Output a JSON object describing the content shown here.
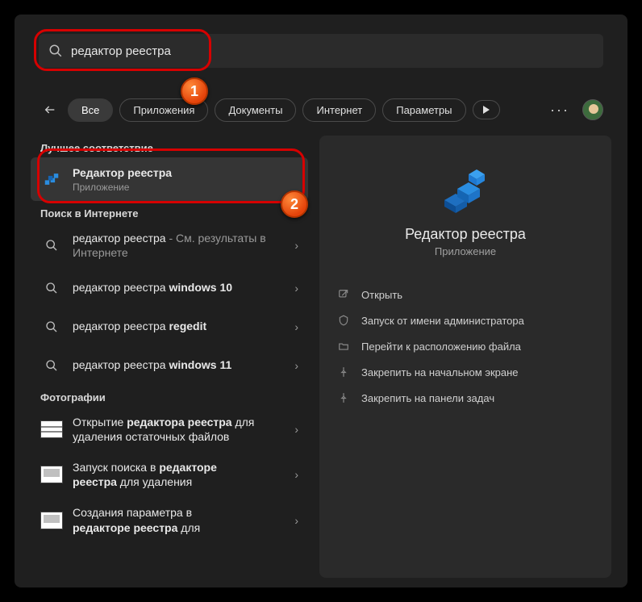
{
  "search": {
    "query": "редактор реестра"
  },
  "filters": {
    "items": [
      {
        "label": "Все",
        "active": true
      },
      {
        "label": "Приложения",
        "active": false
      },
      {
        "label": "Документы",
        "active": false
      },
      {
        "label": "Интернет",
        "active": false
      },
      {
        "label": "Параметры",
        "active": false
      }
    ]
  },
  "annotations": {
    "b1": "1",
    "b2": "2"
  },
  "sections": {
    "best_label": "Лучшее соответствие",
    "web_label": "Поиск в Интернете",
    "photos_label": "Фотографии"
  },
  "best": {
    "title": "Редактор реестра",
    "subtitle": "Приложение"
  },
  "web_results": [
    {
      "prefix": "редактор реестра",
      "suffix": " - См. результаты в Интернете"
    },
    {
      "prefix": "редактор реестра ",
      "bold": "windows 10"
    },
    {
      "prefix": "редактор реестра ",
      "bold": "regedit"
    },
    {
      "prefix": "редактор реестра ",
      "bold": "windows 11"
    }
  ],
  "photo_results": [
    {
      "line1a": "Открытие ",
      "line1b": "редактора реестра",
      "line1c": " для",
      "line2": "удаления остаточных файлов"
    },
    {
      "line1a": "Запуск поиска в ",
      "line1b": "редакторе",
      "line1c": "",
      "line2b": "реестра",
      "line2c": " для удаления"
    },
    {
      "line1a": "Создания параметра в",
      "line1b": "",
      "line1c": "",
      "line2b": "редакторе реестра",
      "line2c": " для"
    }
  ],
  "panel": {
    "title": "Редактор реестра",
    "subtitle": "Приложение",
    "actions": [
      {
        "icon": "open",
        "label": "Открыть"
      },
      {
        "icon": "admin",
        "label": "Запуск от имени администратора"
      },
      {
        "icon": "folder",
        "label": "Перейти к расположению файла"
      },
      {
        "icon": "pin",
        "label": "Закрепить на начальном экране"
      },
      {
        "icon": "pin",
        "label": "Закрепить на панели задач"
      }
    ]
  }
}
